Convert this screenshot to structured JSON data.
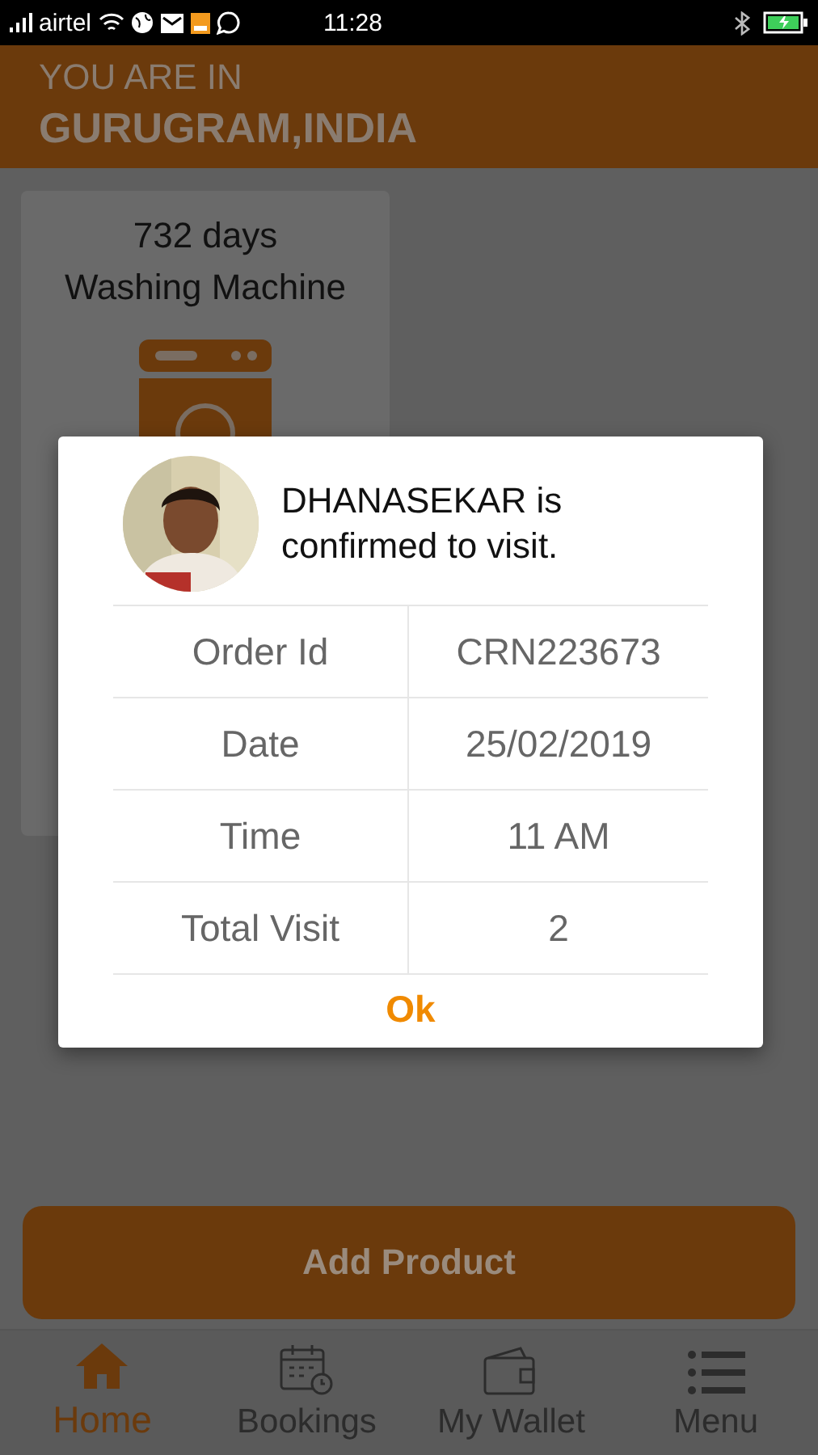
{
  "status_bar": {
    "carrier": "airtel",
    "time": "11:28"
  },
  "header": {
    "label": "YOU ARE IN",
    "location": "GURUGRAM,INDIA"
  },
  "product_card": {
    "duration": "732 days",
    "name": "Washing Machine"
  },
  "dialog": {
    "message": "DHANASEKAR is confirmed to visit.",
    "rows": [
      {
        "label": "Order Id",
        "value": "CRN223673"
      },
      {
        "label": "Date",
        "value": "25/02/2019"
      },
      {
        "label": "Time",
        "value": "11 AM"
      },
      {
        "label": "Total Visit",
        "value": "2"
      }
    ],
    "button": "Ok"
  },
  "add_button": "Add Product",
  "nav": [
    {
      "label": "Home",
      "kind": "home",
      "selected": true
    },
    {
      "label": "Bookings",
      "kind": "calendar",
      "selected": false
    },
    {
      "label": "My Wallet",
      "kind": "wallet",
      "selected": false
    },
    {
      "label": "Menu",
      "kind": "menu",
      "selected": false
    }
  ]
}
